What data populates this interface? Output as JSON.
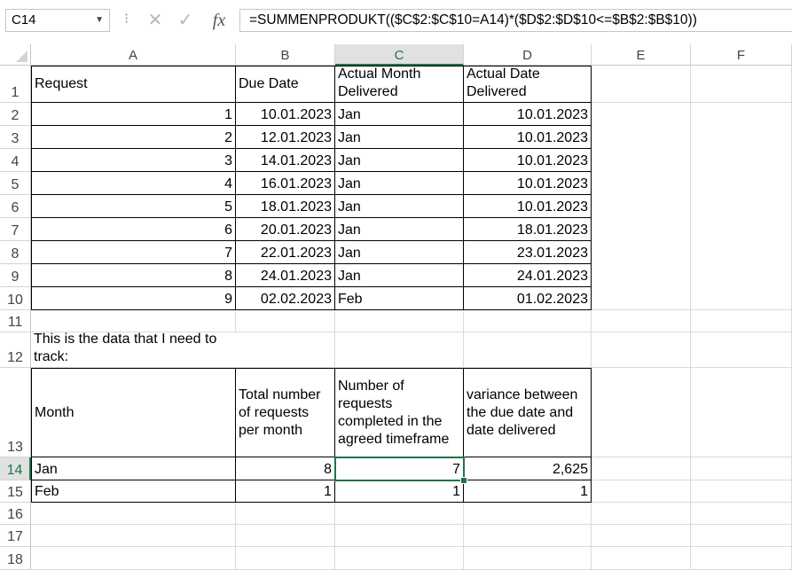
{
  "formula_bar": {
    "name_box": "C14",
    "cancel_icon": "✕",
    "enter_icon": "✓",
    "fx_label": "fx",
    "formula": "=SUMMENPRODUKT(($C$2:$C$10=A14)*($D$2:$D$10<=$B$2:$B$10))"
  },
  "columns": [
    "A",
    "B",
    "C",
    "D",
    "E",
    "F"
  ],
  "rows": [
    "1",
    "2",
    "3",
    "4",
    "5",
    "6",
    "7",
    "8",
    "9",
    "10",
    "11",
    "12",
    "13",
    "14",
    "15",
    "16",
    "17",
    "18"
  ],
  "table1": {
    "headers": [
      "Request",
      "Due Date",
      "Actual Month Delivered",
      "Actual Date Delivered"
    ],
    "rows": [
      [
        "1",
        "10.01.2023",
        "Jan",
        "10.01.2023"
      ],
      [
        "2",
        "12.01.2023",
        "Jan",
        "10.01.2023"
      ],
      [
        "3",
        "14.01.2023",
        "Jan",
        "10.01.2023"
      ],
      [
        "4",
        "16.01.2023",
        "Jan",
        "10.01.2023"
      ],
      [
        "5",
        "18.01.2023",
        "Jan",
        "10.01.2023"
      ],
      [
        "6",
        "20.01.2023",
        "Jan",
        "18.01.2023"
      ],
      [
        "7",
        "22.01.2023",
        "Jan",
        "23.01.2023"
      ],
      [
        "8",
        "24.01.2023",
        "Jan",
        "24.01.2023"
      ],
      [
        "9",
        "02.02.2023",
        "Feb",
        "01.02.2023"
      ]
    ]
  },
  "note": "This is the data that I need to track:",
  "table2": {
    "headers": [
      "Month",
      "Total number of requests per month",
      "Number of requests completed in the agreed timeframe",
      "variance between the due date and date delivered"
    ],
    "rows": [
      [
        "Jan",
        "8",
        "7",
        "2,625"
      ],
      [
        "Feb",
        "1",
        "1",
        "1"
      ]
    ]
  },
  "selection": {
    "cell": "C14",
    "column": "C",
    "row": "14"
  }
}
